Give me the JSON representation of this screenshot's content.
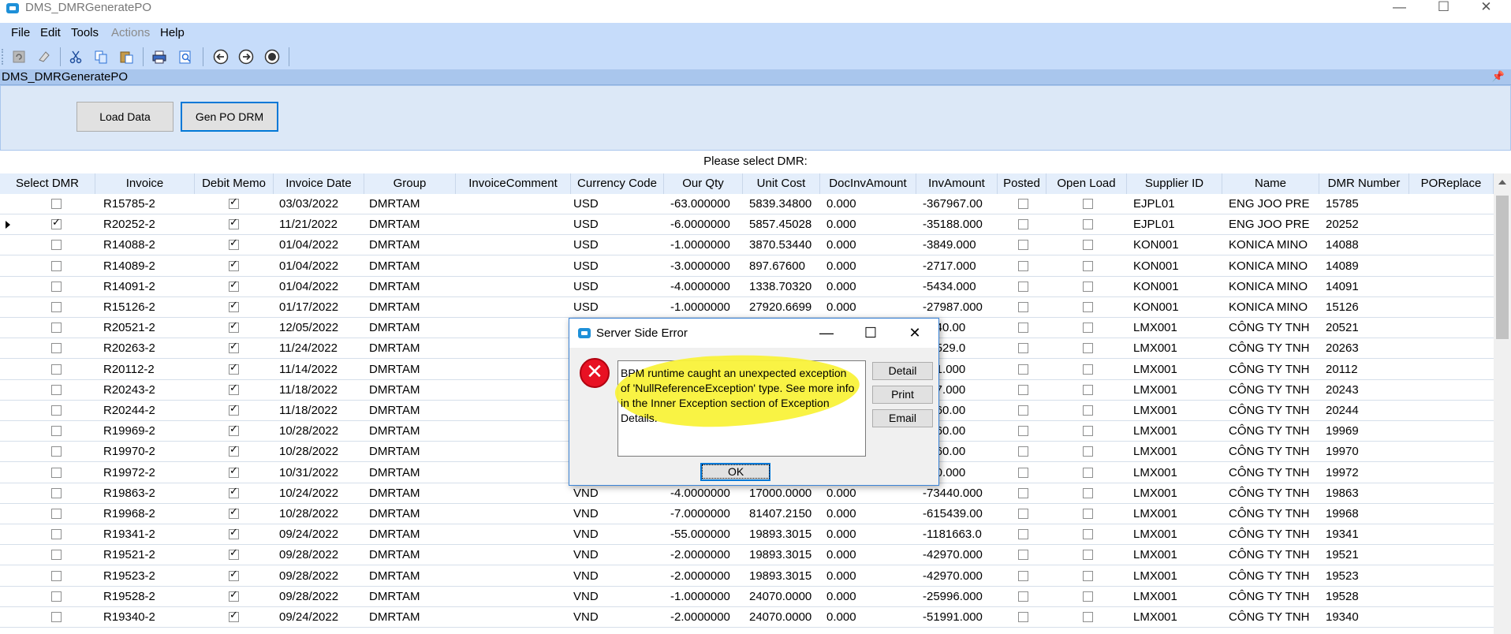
{
  "window": {
    "title": "DMS_DMRGeneratePO"
  },
  "menu": [
    {
      "label": "File",
      "disabled": false
    },
    {
      "label": "Edit",
      "disabled": false
    },
    {
      "label": "Tools",
      "disabled": false
    },
    {
      "label": "Actions",
      "disabled": true
    },
    {
      "label": "Help",
      "disabled": false
    }
  ],
  "toolbar": {
    "icons": [
      "refresh-icon",
      "clear-icon",
      "cut-icon",
      "copy-icon",
      "paste-icon",
      "print-icon",
      "print-preview-icon",
      "back-icon",
      "forward-icon",
      "stop-icon"
    ]
  },
  "panel": {
    "title": "DMS_DMRGeneratePO"
  },
  "buttons": {
    "load_data": "Load Data",
    "gen_po": "Gen PO DRM"
  },
  "grid": {
    "caption": "Please select DMR:",
    "columns": [
      "Select DMR",
      "Invoice",
      "Debit Memo",
      "Invoice Date",
      "Group",
      "InvoiceComment",
      "Currency Code",
      "Our Qty",
      "Unit Cost",
      "DocInvAmount",
      "InvAmount",
      "Posted",
      "Open Load",
      "Supplier ID",
      "Name",
      "DMR Number",
      "POReplace"
    ],
    "rows": [
      {
        "select": false,
        "invoice": "R15785-2",
        "debit": true,
        "date": "03/03/2022",
        "group": "DMRTAM",
        "currency": "USD",
        "qty": "-63.000000",
        "unit_cost": "5839.34800",
        "docinv": "0.000",
        "invamount": "-367967.00",
        "posted": false,
        "openload": false,
        "supplier": "EJPL01",
        "name": "ENG JOO PRE",
        "dmr": "15785",
        "current": false
      },
      {
        "select": true,
        "invoice": "R20252-2",
        "debit": true,
        "date": "11/21/2022",
        "group": "DMRTAM",
        "currency": "USD",
        "qty": "-6.0000000",
        "unit_cost": "5857.45028",
        "docinv": "0.000",
        "invamount": "-35188.000",
        "posted": false,
        "openload": false,
        "supplier": "EJPL01",
        "name": "ENG JOO PRE",
        "dmr": "20252",
        "current": true
      },
      {
        "select": false,
        "invoice": "R14088-2",
        "debit": true,
        "date": "01/04/2022",
        "group": "DMRTAM",
        "currency": "USD",
        "qty": "-1.0000000",
        "unit_cost": "3870.53440",
        "docinv": "0.000",
        "invamount": "-3849.000",
        "posted": false,
        "openload": false,
        "supplier": "KON001",
        "name": "KONICA MINO",
        "dmr": "14088",
        "current": false
      },
      {
        "select": false,
        "invoice": "R14089-2",
        "debit": true,
        "date": "01/04/2022",
        "group": "DMRTAM",
        "currency": "USD",
        "qty": "-3.0000000",
        "unit_cost": "897.67600",
        "docinv": "0.000",
        "invamount": "-2717.000",
        "posted": false,
        "openload": false,
        "supplier": "KON001",
        "name": "KONICA MINO",
        "dmr": "14089",
        "current": false
      },
      {
        "select": false,
        "invoice": "R14091-2",
        "debit": true,
        "date": "01/04/2022",
        "group": "DMRTAM",
        "currency": "USD",
        "qty": "-4.0000000",
        "unit_cost": "1338.70320",
        "docinv": "0.000",
        "invamount": "-5434.000",
        "posted": false,
        "openload": false,
        "supplier": "KON001",
        "name": "KONICA MINO",
        "dmr": "14091",
        "current": false
      },
      {
        "select": false,
        "invoice": "R15126-2",
        "debit": true,
        "date": "01/17/2022",
        "group": "DMRTAM",
        "currency": "USD",
        "qty": "-1.0000000",
        "unit_cost": "27920.6699",
        "docinv": "0.000",
        "invamount": "-27987.000",
        "posted": false,
        "openload": false,
        "supplier": "KON001",
        "name": "KONICA MINO",
        "dmr": "15126",
        "current": false
      },
      {
        "select": false,
        "invoice": "R20521-2",
        "debit": true,
        "date": "12/05/2022",
        "group": "DMRTAM",
        "currency": "",
        "qty": "",
        "unit_cost": "",
        "docinv": "",
        "invamount": "5240.00",
        "posted": false,
        "openload": false,
        "supplier": "LMX001",
        "name": "CÔNG TY TNH",
        "dmr": "20521",
        "current": false
      },
      {
        "select": false,
        "invoice": "R20263-2",
        "debit": true,
        "date": "11/24/2022",
        "group": "DMRTAM",
        "currency": "",
        "qty": "",
        "unit_cost": "",
        "docinv": "",
        "invamount": "81529.0",
        "posted": false,
        "openload": false,
        "supplier": "LMX001",
        "name": "CÔNG TY TNH",
        "dmr": "20263",
        "current": false
      },
      {
        "select": false,
        "invoice": "R20112-2",
        "debit": true,
        "date": "11/14/2022",
        "group": "DMRTAM",
        "currency": "",
        "qty": "",
        "unit_cost": "",
        "docinv": "",
        "invamount": "991.000",
        "posted": false,
        "openload": false,
        "supplier": "LMX001",
        "name": "CÔNG TY TNH",
        "dmr": "20112",
        "current": false
      },
      {
        "select": false,
        "invoice": "R20243-2",
        "debit": true,
        "date": "11/18/2022",
        "group": "DMRTAM",
        "currency": "",
        "qty": "",
        "unit_cost": "",
        "docinv": "",
        "invamount": "397.000",
        "posted": false,
        "openload": false,
        "supplier": "LMX001",
        "name": "CÔNG TY TNH",
        "dmr": "20243",
        "current": false
      },
      {
        "select": false,
        "invoice": "R20244-2",
        "debit": true,
        "date": "11/18/2022",
        "group": "DMRTAM",
        "currency": "",
        "qty": "",
        "unit_cost": "",
        "docinv": "",
        "invamount": "0160.00",
        "posted": false,
        "openload": false,
        "supplier": "LMX001",
        "name": "CÔNG TY TNH",
        "dmr": "20244",
        "current": false
      },
      {
        "select": false,
        "invoice": "R19969-2",
        "debit": true,
        "date": "10/28/2022",
        "group": "DMRTAM",
        "currency": "",
        "qty": "",
        "unit_cost": "",
        "docinv": "",
        "invamount": "3760.00",
        "posted": false,
        "openload": false,
        "supplier": "LMX001",
        "name": "CÔNG TY TNH",
        "dmr": "19969",
        "current": false
      },
      {
        "select": false,
        "invoice": "R19970-2",
        "debit": true,
        "date": "10/28/2022",
        "group": "DMRTAM",
        "currency": "",
        "qty": "",
        "unit_cost": "",
        "docinv": "",
        "invamount": "3760.00",
        "posted": false,
        "openload": false,
        "supplier": "LMX001",
        "name": "CÔNG TY TNH",
        "dmr": "19970",
        "current": false
      },
      {
        "select": false,
        "invoice": "R19972-2",
        "debit": true,
        "date": "10/31/2022",
        "group": "DMRTAM",
        "currency": "",
        "qty": "",
        "unit_cost": "",
        "docinv": "",
        "invamount": "360.000",
        "posted": false,
        "openload": false,
        "supplier": "LMX001",
        "name": "CÔNG TY TNH",
        "dmr": "19972",
        "current": false
      },
      {
        "select": false,
        "invoice": "R19863-2",
        "debit": true,
        "date": "10/24/2022",
        "group": "DMRTAM",
        "currency": "VND",
        "qty": "-4.0000000",
        "unit_cost": "17000.0000",
        "docinv": "0.000",
        "invamount": "-73440.000",
        "posted": false,
        "openload": false,
        "supplier": "LMX001",
        "name": "CÔNG TY TNH",
        "dmr": "19863",
        "current": false
      },
      {
        "select": false,
        "invoice": "R19968-2",
        "debit": true,
        "date": "10/28/2022",
        "group": "DMRTAM",
        "currency": "VND",
        "qty": "-7.0000000",
        "unit_cost": "81407.2150",
        "docinv": "0.000",
        "invamount": "-615439.00",
        "posted": false,
        "openload": false,
        "supplier": "LMX001",
        "name": "CÔNG TY TNH",
        "dmr": "19968",
        "current": false
      },
      {
        "select": false,
        "invoice": "R19341-2",
        "debit": true,
        "date": "09/24/2022",
        "group": "DMRTAM",
        "currency": "VND",
        "qty": "-55.000000",
        "unit_cost": "19893.3015",
        "docinv": "0.000",
        "invamount": "-1181663.0",
        "posted": false,
        "openload": false,
        "supplier": "LMX001",
        "name": "CÔNG TY TNH",
        "dmr": "19341",
        "current": false
      },
      {
        "select": false,
        "invoice": "R19521-2",
        "debit": true,
        "date": "09/28/2022",
        "group": "DMRTAM",
        "currency": "VND",
        "qty": "-2.0000000",
        "unit_cost": "19893.3015",
        "docinv": "0.000",
        "invamount": "-42970.000",
        "posted": false,
        "openload": false,
        "supplier": "LMX001",
        "name": "CÔNG TY TNH",
        "dmr": "19521",
        "current": false
      },
      {
        "select": false,
        "invoice": "R19523-2",
        "debit": true,
        "date": "09/28/2022",
        "group": "DMRTAM",
        "currency": "VND",
        "qty": "-2.0000000",
        "unit_cost": "19893.3015",
        "docinv": "0.000",
        "invamount": "-42970.000",
        "posted": false,
        "openload": false,
        "supplier": "LMX001",
        "name": "CÔNG TY TNH",
        "dmr": "19523",
        "current": false
      },
      {
        "select": false,
        "invoice": "R19528-2",
        "debit": true,
        "date": "09/28/2022",
        "group": "DMRTAM",
        "currency": "VND",
        "qty": "-1.0000000",
        "unit_cost": "24070.0000",
        "docinv": "0.000",
        "invamount": "-25996.000",
        "posted": false,
        "openload": false,
        "supplier": "LMX001",
        "name": "CÔNG TY TNH",
        "dmr": "19528",
        "current": false
      },
      {
        "select": false,
        "invoice": "R19340-2",
        "debit": true,
        "date": "09/24/2022",
        "group": "DMRTAM",
        "currency": "VND",
        "qty": "-2.0000000",
        "unit_cost": "24070.0000",
        "docinv": "0.000",
        "invamount": "-51991.000",
        "posted": false,
        "openload": false,
        "supplier": "LMX001",
        "name": "CÔNG TY TNH",
        "dmr": "19340",
        "current": false
      }
    ]
  },
  "dialog": {
    "title": "Server Side Error",
    "message": "BPM runtime caught an unexpected exception of 'NullReferenceException' type. See more info in the Inner Exception section of Exception Details.",
    "detail_label": "Detail",
    "print_label": "Print",
    "email_label": "Email",
    "ok_label": "OK"
  },
  "colors": {
    "menubar_bg": "#c6dcfa",
    "grid_header_bg": "#e4eefb",
    "highlight": "#f9f23a",
    "error_red": "#e81123"
  }
}
